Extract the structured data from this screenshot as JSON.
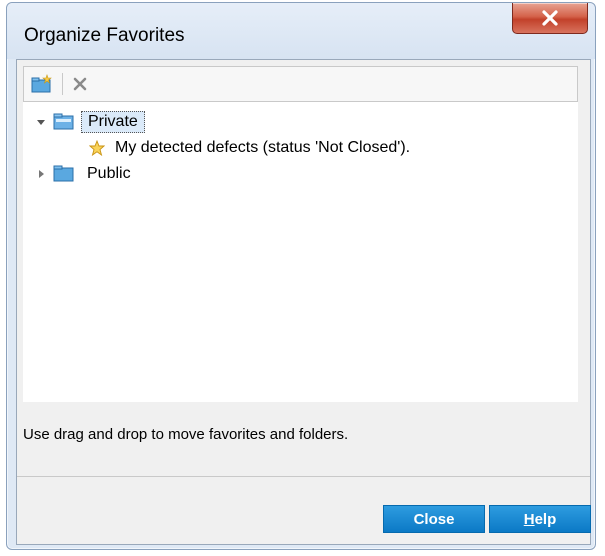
{
  "window": {
    "title": "Organize Favorites"
  },
  "toolbar": {
    "new_folder_icon": "new-folder-icon",
    "delete_icon": "delete-icon"
  },
  "tree": {
    "items": [
      {
        "label": "Private",
        "expanded": true
      },
      {
        "label": "My detected defects (status 'Not Closed')."
      },
      {
        "label": "Public",
        "expanded": false
      }
    ]
  },
  "hint": "Use drag and drop to move favorites and folders.",
  "buttons": {
    "close": "Close",
    "help_prefix": "H",
    "help_rest": "elp"
  },
  "colors": {
    "button": "#1a8bd6",
    "selection": "#dbeaf9",
    "title_close": "#c9503a"
  }
}
